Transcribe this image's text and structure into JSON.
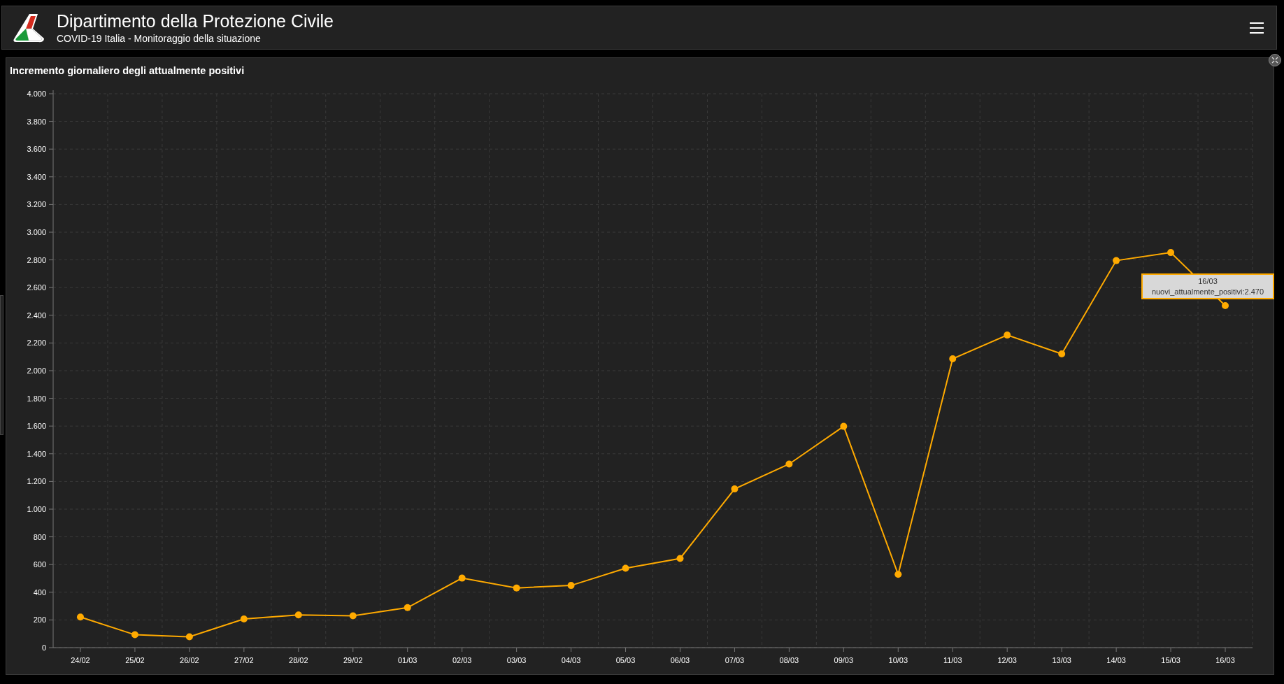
{
  "header": {
    "title": "Dipartimento della Protezione Civile",
    "subtitle": "COVID-19 Italia - Monitoraggio della situazione"
  },
  "panel": {
    "title": "Incremento giornaliero degli attualmente positivi",
    "chart_data": {
      "type": "line",
      "categories": [
        "24/02",
        "25/02",
        "26/02",
        "27/02",
        "28/02",
        "29/02",
        "01/03",
        "02/03",
        "03/03",
        "04/03",
        "05/03",
        "06/03",
        "07/03",
        "08/03",
        "09/03",
        "10/03",
        "11/03",
        "12/03",
        "13/03",
        "14/03",
        "15/03",
        "16/03"
      ],
      "grid": true,
      "series": [
        {
          "color": "#ffaa00",
          "marker": true,
          "values": [
            221,
            93,
            78,
            207,
            236,
            230,
            289,
            502,
            431,
            449,
            573,
            644,
            1146,
            1326,
            1598,
            529,
            2086,
            2257,
            2121,
            2795,
            2853,
            2470
          ]
        }
      ],
      "ylim": [
        0,
        4000
      ],
      "yticks": [
        {
          "value": 0,
          "label": "0"
        },
        {
          "value": 200,
          "label": "200"
        },
        {
          "value": 400,
          "label": "400"
        },
        {
          "value": 600,
          "label": "600"
        },
        {
          "value": 800,
          "label": "800"
        },
        {
          "value": 1000,
          "label": "1.000"
        },
        {
          "value": 1200,
          "label": "1.200"
        },
        {
          "value": 1400,
          "label": "1.400"
        },
        {
          "value": 1600,
          "label": "1.600"
        },
        {
          "value": 1800,
          "label": "1.800"
        },
        {
          "value": 2000,
          "label": "2.000"
        },
        {
          "value": 2200,
          "label": "2.200"
        },
        {
          "value": 2400,
          "label": "2.400"
        },
        {
          "value": 2600,
          "label": "2.600"
        },
        {
          "value": 2800,
          "label": "2.800"
        },
        {
          "value": 3000,
          "label": "3.000"
        },
        {
          "value": 3200,
          "label": "3.200"
        },
        {
          "value": 3400,
          "label": "3.400"
        },
        {
          "value": 3600,
          "label": "3.600"
        },
        {
          "value": 3800,
          "label": "3.800"
        },
        {
          "value": 4000,
          "label": "4.000"
        }
      ]
    },
    "tooltip": {
      "title": "16/03",
      "text": "nuovi_attualmente_positivi:2.470"
    }
  }
}
